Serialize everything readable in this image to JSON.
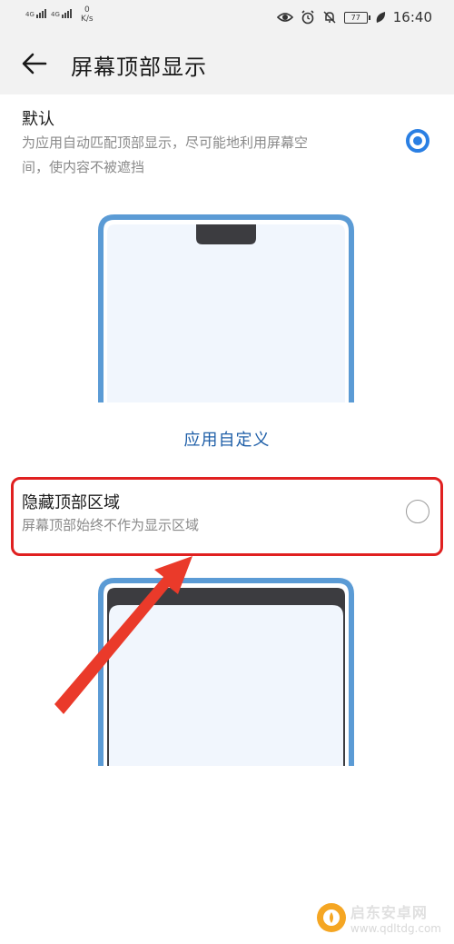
{
  "status_bar": {
    "signal1": "4G",
    "signal2": "4G",
    "speed_value": "0",
    "speed_unit": "K/s",
    "battery": "77",
    "time": "16:40"
  },
  "title_bar": {
    "title": "屏幕顶部显示"
  },
  "options": [
    {
      "title": "默认",
      "desc_line1": "为应用自动匹配顶部显示，尽可能地利用屏幕空",
      "desc_line2": "间，使内容不被遮挡",
      "selected": true
    },
    {
      "title": "隐藏顶部区域",
      "desc": "屏幕顶部始终不作为显示区域",
      "selected": false
    }
  ],
  "section_link": "应用自定义",
  "colors": {
    "accent": "#2a7fe3",
    "phone_frame": "#5b9bd5",
    "highlight": "#e02020",
    "arrow": "#ea3a2a"
  },
  "watermark": {
    "brand": "启东安卓网",
    "url": "www.qdltdg.com"
  }
}
